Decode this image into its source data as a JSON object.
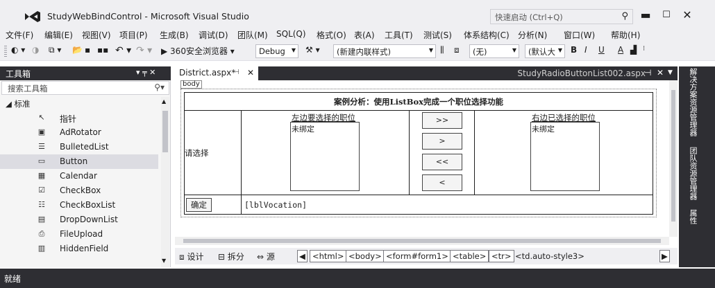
{
  "window": {
    "title": "StudyWebBindControl - Microsoft Visual Studio",
    "quick_launch_placeholder": "快速启动 (Ctrl+Q)"
  },
  "menu": [
    "文件(F)",
    "编辑(E)",
    "视图(V)",
    "项目(P)",
    "生成(B)",
    "调试(D)",
    "团队(M)",
    "SQL(Q)",
    "格式(O)",
    "表(A)",
    "工具(T)",
    "测试(S)",
    "体系结构(C)",
    "分析(N)",
    "窗口(W)",
    "帮助(H)"
  ],
  "toolbar": {
    "run_label": "360安全浏览器",
    "config": "Debug",
    "style_combo": "(新建内联样式)",
    "target_combo": "(无)",
    "font_combo": "(默认大",
    "bold": "B",
    "italic": "I",
    "underline": "U",
    "font_color": "A"
  },
  "toolbox": {
    "title": "工具箱",
    "pin": "▾ ╤ ✕",
    "search_placeholder": "搜索工具箱",
    "category": "◢ 标准",
    "items": [
      {
        "label": "指针",
        "icon": "pointer-icon",
        "glyph": "↖"
      },
      {
        "label": "AdRotator",
        "icon": "adrotator-icon",
        "glyph": "▣"
      },
      {
        "label": "BulletedList",
        "icon": "bulleted-list-icon",
        "glyph": "☰"
      },
      {
        "label": "Button",
        "icon": "button-icon",
        "glyph": "▭"
      },
      {
        "label": "Calendar",
        "icon": "calendar-icon",
        "glyph": "▦"
      },
      {
        "label": "CheckBox",
        "icon": "checkbox-icon",
        "glyph": "☑"
      },
      {
        "label": "CheckBoxList",
        "icon": "checkbox-list-icon",
        "glyph": "☷"
      },
      {
        "label": "DropDownList",
        "icon": "dropdown-list-icon",
        "glyph": "▤"
      },
      {
        "label": "FileUpload",
        "icon": "file-upload-icon",
        "glyph": "⎙"
      },
      {
        "label": "HiddenField",
        "icon": "hidden-field-icon",
        "glyph": "▥"
      }
    ]
  },
  "editor": {
    "active_tab": "District.aspx*",
    "other_tab": "StudyRadioButtonList002.aspx",
    "body_tag": "body",
    "caption": "案例分析：使用ListBox完成一个职位选择功能",
    "prompt": "请选择",
    "left_header": "左边要选择的职位",
    "right_header": "右边已选择的职位",
    "unbound": "未绑定",
    "move_all_right": ">>",
    "move_right": ">",
    "move_all_left": "<<",
    "move_left": "<",
    "confirm": "确定",
    "label_text": "[lblVocation]"
  },
  "views": {
    "design": "设计",
    "split": "拆分",
    "source": "源"
  },
  "breadcrumbs": [
    "<html>",
    "<body>",
    "<form#form1>",
    "<table>",
    "<tr>",
    "<td.auto-style3>"
  ],
  "side_tabs": [
    "解决方案资源管理器",
    "团队资源管理器",
    "属性"
  ],
  "status": "就绪"
}
